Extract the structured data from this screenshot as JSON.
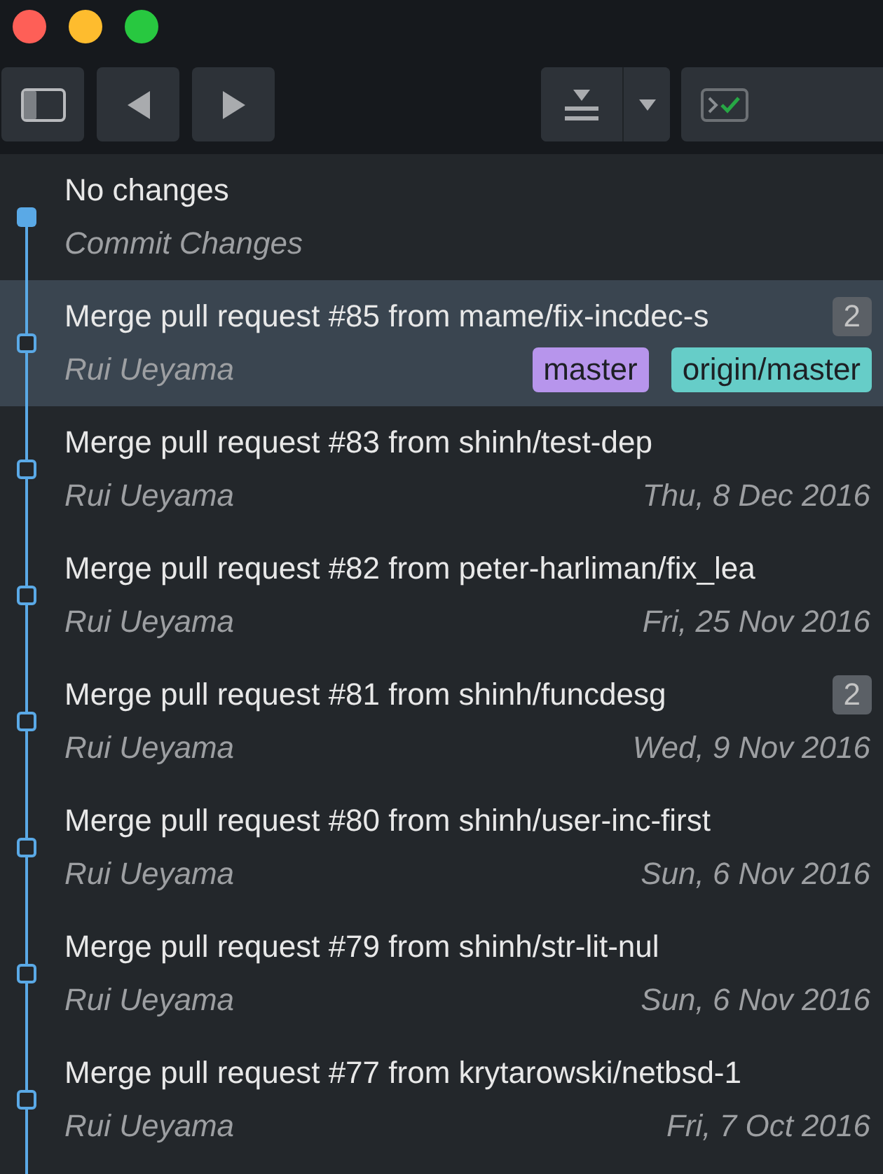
{
  "commits": [
    {
      "kind": "working",
      "title": "No changes",
      "subtitle": "Commit Changes",
      "selected": false
    },
    {
      "kind": "commit",
      "title": "Merge pull request #85 from mame/fix-incdec-s",
      "author": "Rui Ueyama",
      "count": "2",
      "tags": [
        {
          "label": "master",
          "color": "#b795ec"
        },
        {
          "label": "origin/master",
          "color": "#66cdc8"
        }
      ],
      "selected": true
    },
    {
      "kind": "commit",
      "title": "Merge pull request #83 from shinh/test-dep",
      "author": "Rui Ueyama",
      "date": "Thu, 8 Dec 2016",
      "selected": false
    },
    {
      "kind": "commit",
      "title": "Merge pull request #82 from peter-harliman/fix_lea",
      "author": "Rui Ueyama",
      "date": "Fri, 25 Nov 2016",
      "selected": false
    },
    {
      "kind": "commit",
      "title": "Merge pull request #81 from shinh/funcdesg",
      "author": "Rui Ueyama",
      "count": "2",
      "date": "Wed, 9 Nov 2016",
      "selected": false
    },
    {
      "kind": "commit",
      "title": "Merge pull request #80 from shinh/user-inc-first",
      "author": "Rui Ueyama",
      "date": "Sun, 6 Nov 2016",
      "selected": false
    },
    {
      "kind": "commit",
      "title": "Merge pull request #79 from shinh/str-lit-nul",
      "author": "Rui Ueyama",
      "date": "Sun, 6 Nov 2016",
      "selected": false
    },
    {
      "kind": "commit",
      "title": "Merge pull request #77 from krytarowski/netbsd-1",
      "author": "Rui Ueyama",
      "date": "Fri, 7 Oct 2016",
      "selected": false
    }
  ]
}
